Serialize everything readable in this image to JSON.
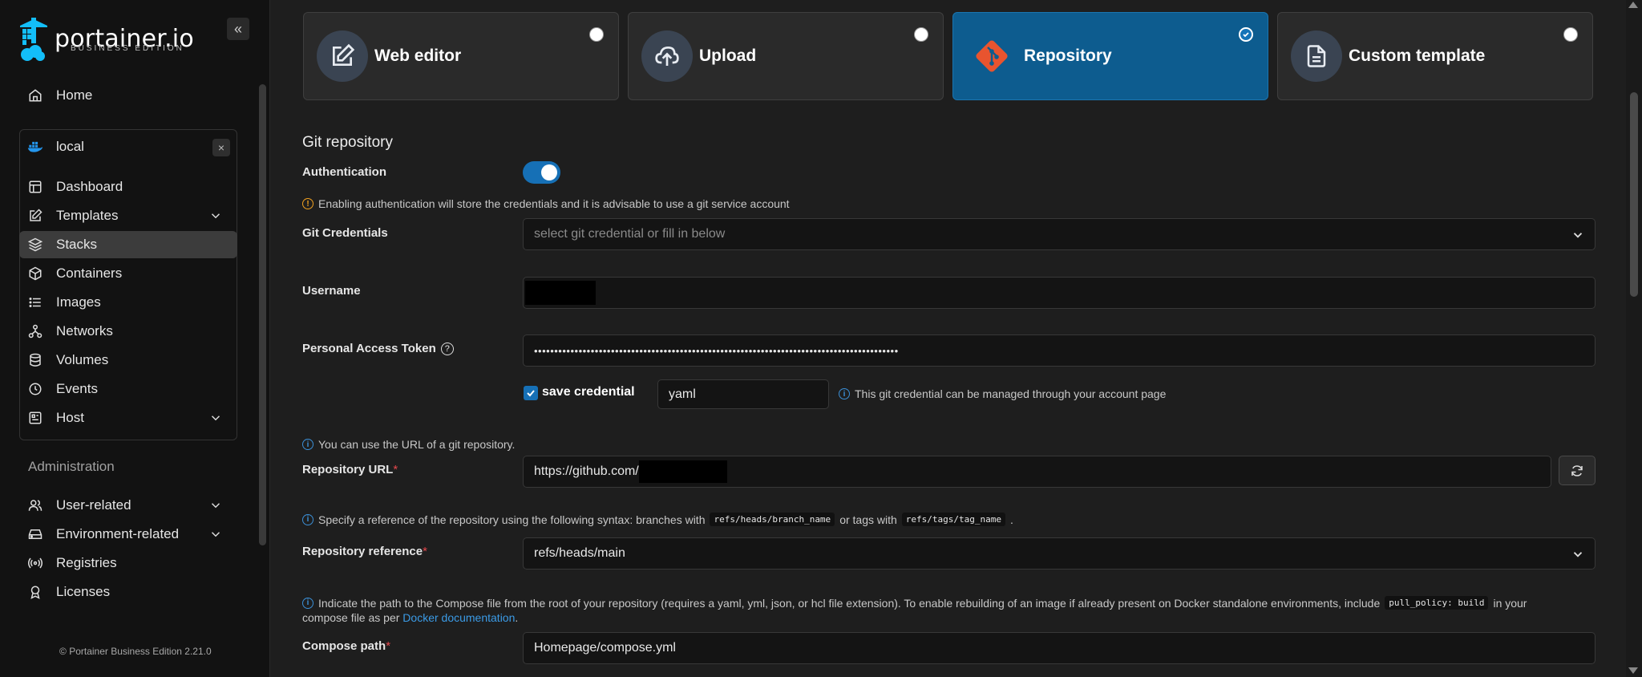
{
  "sidebar": {
    "logo_name": "portainer.io",
    "logo_sub": "BUSINESS EDITION",
    "collapse_icon": "«",
    "home": "Home",
    "environment": {
      "name": "local",
      "close": "×"
    },
    "env_items": [
      {
        "label": "Dashboard",
        "icon": "dashboard-icon"
      },
      {
        "label": "Templates",
        "icon": "edit-icon",
        "expandable": true
      },
      {
        "label": "Stacks",
        "icon": "layers-icon",
        "active": true
      },
      {
        "label": "Containers",
        "icon": "box-icon"
      },
      {
        "label": "Images",
        "icon": "list-icon"
      },
      {
        "label": "Networks",
        "icon": "network-icon"
      },
      {
        "label": "Volumes",
        "icon": "database-icon"
      },
      {
        "label": "Events",
        "icon": "clock-icon"
      },
      {
        "label": "Host",
        "icon": "host-icon",
        "expandable": true
      }
    ],
    "admin_label": "Administration",
    "admin_items": [
      {
        "label": "User-related",
        "icon": "users-icon",
        "expandable": true
      },
      {
        "label": "Environment-related",
        "icon": "hard-drive-icon",
        "expandable": true
      },
      {
        "label": "Registries",
        "icon": "radio-icon"
      },
      {
        "label": "Licenses",
        "icon": "award-icon"
      }
    ],
    "footer": "Portainer Business Edition  2.21.0"
  },
  "methods": [
    {
      "label": "Web editor",
      "icon": "edit-icon",
      "selected": false
    },
    {
      "label": "Upload",
      "icon": "upload-cloud-icon",
      "selected": false
    },
    {
      "label": "Repository",
      "icon": "git-icon",
      "selected": true
    },
    {
      "label": "Custom template",
      "icon": "file-text-icon",
      "selected": false
    }
  ],
  "form": {
    "section_title": "Git repository",
    "auth_label": "Authentication",
    "auth_enabled": true,
    "auth_warning": "Enabling authentication will store the credentials and it is advisable to use a git service account",
    "git_credentials_label": "Git Credentials",
    "git_credentials_placeholder": "select git credential or fill in below",
    "username_label": "Username",
    "pat_label": "Personal Access Token",
    "pat_value": "••••••••••••••••••••••••••••••••••••••••••••••••••••••••••••••••••••••••••••••••••••••••••",
    "save_credential_label": "save credential",
    "save_credential_checked": true,
    "credential_name": "yaml",
    "credential_note": "This git credential can be managed through your account page",
    "url_note": "You can use the URL of a git repository.",
    "repo_url_label": "Repository URL",
    "repo_url_value": "https://github.com/",
    "ref_note_pre": "Specify a reference of the repository using the following syntax: branches with",
    "ref_note_code1": "refs/heads/branch_name",
    "ref_note_mid": "or tags with",
    "ref_note_code2": "refs/tags/tag_name",
    "ref_note_end": ".",
    "repo_ref_label": "Repository reference",
    "repo_ref_value": "refs/heads/main",
    "compose_note_pre": "Indicate the path to the Compose file from the root of your repository (requires a yaml, yml, json, or hcl file extension).  To enable rebuilding of an image if already present on Docker standalone environments, include",
    "compose_note_code": "pull_policy: build",
    "compose_note_post": "in your",
    "compose_note_line2_pre": "compose file as per",
    "compose_note_link": "Docker documentation",
    "compose_note_line2_end": ".",
    "compose_path_label": "Compose path",
    "compose_path_value": "Homepage/compose.yml",
    "required_mark": "*"
  },
  "colors": {
    "accent": "#1670b6",
    "selected_card": "#0d5c8f",
    "git_orange": "#e8542f",
    "warning": "#f0a020",
    "required": "#e5484d"
  }
}
